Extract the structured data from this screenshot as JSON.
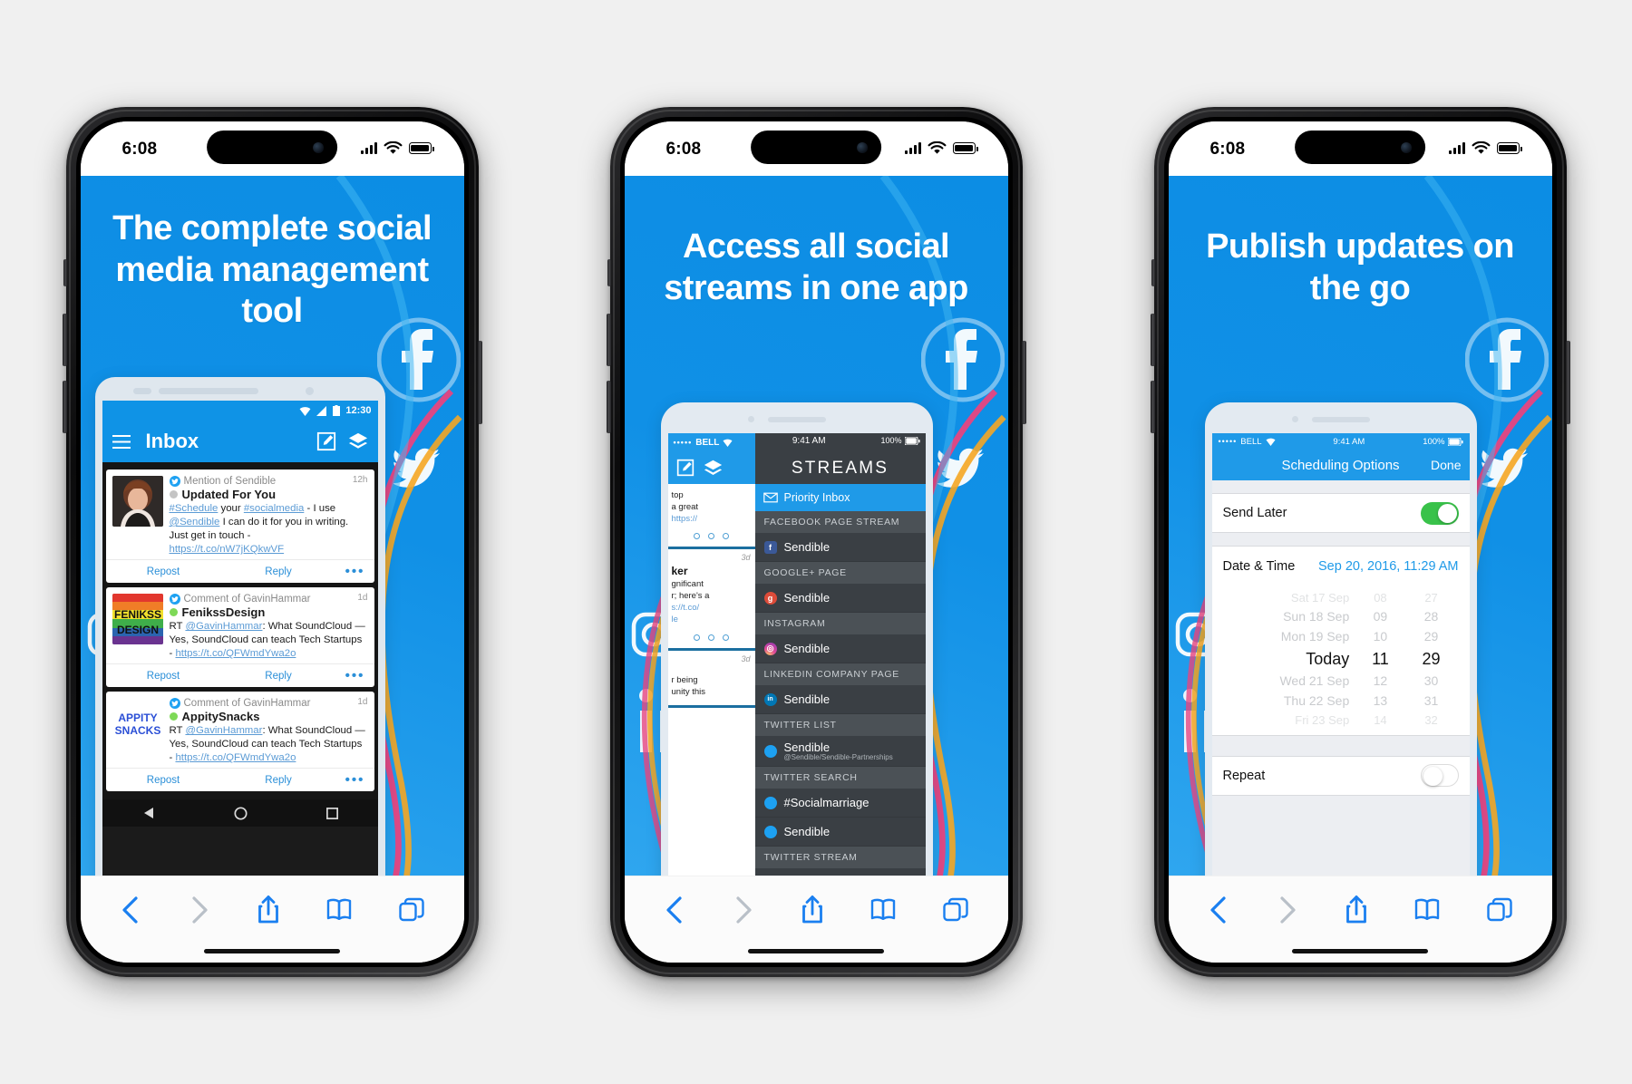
{
  "panels": [
    {
      "status": {
        "time": "6:08",
        "signal_icon": "cellular-bars-icon",
        "wifi_icon": "wifi-icon",
        "battery_icon": "battery-icon"
      },
      "headline": "The complete social media management tool",
      "mock_type": "android-inbox",
      "android": {
        "clock": "12:30",
        "appbar": {
          "menu_icon": "hamburger-menu-icon",
          "title": "Inbox",
          "compose_icon": "compose-icon",
          "layers_icon": "layers-icon"
        },
        "cards": [
          {
            "source": "Mention of Sendible",
            "account": "Updated For You",
            "age": "12h",
            "text": "#Schedule your #socialmedia - I use @Sendible I can do it for you in writing. Just get in touch - https://t.co/nW7jKQkwVF",
            "repost": "Repost",
            "reply": "Reply",
            "more": "•••",
            "avatar_kind": "photo-woman",
            "dot_color": "#c4c4c4"
          },
          {
            "source": "Comment of GavinHammar",
            "account": "FenikssDesign",
            "age": "1d",
            "text": "RT @GavinHammar: What SoundCloud — Yes, SoundCloud can teach Tech Startups - https://t.co/QFWmdYwa2o",
            "repost": "Repost",
            "reply": "Reply",
            "more": "•••",
            "avatar_kind": "fenikss-logo",
            "avatar_text": "FENIKSS DESIGN",
            "dot_color": "#7ed957"
          },
          {
            "source": "Comment of GavinHammar",
            "account": "AppitySnacks",
            "age": "1d",
            "text": "RT @GavinHammar: What SoundCloud — Yes, SoundCloud can teach Tech Startups - https://t.co/QFWmdYwa2o",
            "repost": "Repost",
            "reply": "Reply",
            "more": "•••",
            "avatar_kind": "appity-logo",
            "avatar_text": "APPITY SNACKS",
            "dot_color": "#7ed957"
          }
        ]
      },
      "toolbar": {
        "back": "back-icon",
        "forward": "forward-icon",
        "share": "share-icon",
        "bookmarks": "book-icon",
        "tabs": "tabs-icon"
      }
    },
    {
      "status": {
        "time": "6:08",
        "signal_icon": "cellular-bars-icon",
        "wifi_icon": "wifi-icon",
        "battery_icon": "battery-icon"
      },
      "headline": "Access all social streams in one app",
      "mock_type": "ios-streams",
      "streams": {
        "ios_status": {
          "carrier": "BELL",
          "dots": "•••••",
          "time": "9:41 AM",
          "battery": "100%"
        },
        "toolbar": {
          "compose_icon": "compose-icon",
          "layers_icon": "layers-icon"
        },
        "title": "STREAMS",
        "selected": {
          "label": "Priority Inbox",
          "icon": "envelope-icon"
        },
        "left_cards": [
          {
            "age": "",
            "title": "",
            "text": "top a great https://"
          },
          {
            "age": "3d",
            "title": "ker",
            "text": "gnificant r; here's a s://t.co/ le"
          },
          {
            "age": "3d",
            "title": "",
            "text": "r being unity this"
          }
        ],
        "groups": [
          {
            "label": "FACEBOOK PAGE STREAM",
            "items": [
              {
                "name": "Sendible",
                "sub": "",
                "network": "facebook",
                "color": "#3b5998",
                "glyph": "f"
              }
            ]
          },
          {
            "label": "GOOGLE+ PAGE",
            "items": [
              {
                "name": "Sendible",
                "sub": "",
                "network": "googleplus",
                "color": "#dd4b39",
                "glyph": "g"
              }
            ]
          },
          {
            "label": "INSTAGRAM",
            "items": [
              {
                "name": "Sendible",
                "sub": "",
                "network": "instagram",
                "color": "#c13584",
                "glyph": "◎"
              }
            ]
          },
          {
            "label": "LINKEDIN COMPANY PAGE",
            "items": [
              {
                "name": "Sendible",
                "sub": "",
                "network": "linkedin",
                "color": "#0077b5",
                "glyph": "in"
              }
            ]
          },
          {
            "label": "TWITTER LIST",
            "items": [
              {
                "name": "Sendible",
                "sub": "@Sendible/Sendible-Partnerships",
                "network": "twitter",
                "color": "#1da1f2",
                "glyph": "t"
              }
            ]
          },
          {
            "label": "TWITTER SEARCH",
            "items": [
              {
                "name": "#Socialmarriage",
                "sub": "",
                "network": "twitter",
                "color": "#1da1f2",
                "glyph": "t"
              },
              {
                "name": "Sendible",
                "sub": "",
                "network": "twitter",
                "color": "#1da1f2",
                "glyph": "t"
              }
            ]
          },
          {
            "label": "TWITTER STREAM",
            "items": []
          }
        ]
      },
      "toolbar": {
        "back": "back-icon",
        "forward": "forward-icon",
        "share": "share-icon",
        "bookmarks": "book-icon",
        "tabs": "tabs-icon"
      }
    },
    {
      "status": {
        "time": "6:08",
        "signal_icon": "cellular-bars-icon",
        "wifi_icon": "wifi-icon",
        "battery_icon": "battery-icon"
      },
      "headline": "Publish updates on the go",
      "mock_type": "ios-schedule",
      "schedule": {
        "ios_status": {
          "carrier": "BELL",
          "dots": "•••••",
          "time": "9:41 AM",
          "battery": "100%"
        },
        "nav_title": "Scheduling Options",
        "done_label": "Done",
        "send_later": {
          "label": "Send Later",
          "state": "on"
        },
        "date_time": {
          "label": "Date & Time",
          "value": "Sep 20, 2016, 11:29 AM"
        },
        "picker": [
          {
            "day": "Sat 17 Sep",
            "hour": "08",
            "min": "27",
            "style": "dim"
          },
          {
            "day": "Sun 18 Sep",
            "hour": "09",
            "min": "28",
            "style": "dim2"
          },
          {
            "day": "Mon 19 Sep",
            "hour": "10",
            "min": "29",
            "style": "dim2"
          },
          {
            "day": "Today",
            "hour": "11",
            "min": "29",
            "style": "sel"
          },
          {
            "day": "Wed 21 Sep",
            "hour": "12",
            "min": "30",
            "style": "dim2"
          },
          {
            "day": "Thu 22 Sep",
            "hour": "13",
            "min": "31",
            "style": "dim2"
          },
          {
            "day": "Fri 23 Sep",
            "hour": "14",
            "min": "32",
            "style": "dim"
          }
        ],
        "repeat": {
          "label": "Repeat",
          "state": "off"
        }
      },
      "toolbar": {
        "back": "back-icon",
        "forward": "forward-icon",
        "share": "share-icon",
        "bookmarks": "book-icon",
        "tabs": "tabs-icon"
      }
    }
  ],
  "colors": {
    "brand_blue": "#0f93e6",
    "accent_blue": "#1f9ae8",
    "toggle_green": "#39c24a",
    "link_blue": "#5b9bd5",
    "safari_blue": "#1a7ff0"
  }
}
